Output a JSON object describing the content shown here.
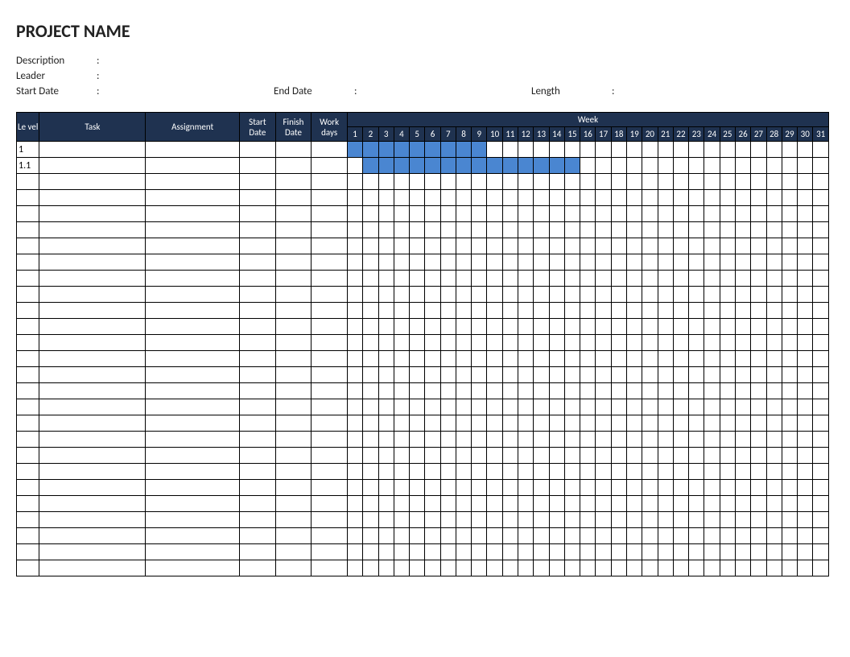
{
  "title": "PROJECT NAME",
  "meta": {
    "description_label": "Description",
    "leader_label": "Leader",
    "start_date_label": "Start Date",
    "end_date_label": "End Date",
    "length_label": "Length",
    "colon": ":"
  },
  "headers": {
    "level": "Le vel",
    "task": "Task",
    "assignment": "Assignment",
    "start_date": "Start Date",
    "finish_date": "Finish Date",
    "work_days": "Work days",
    "week": "Week"
  },
  "day_count": 31,
  "rows": [
    {
      "level": "1",
      "bar_start": 1,
      "bar_end": 9
    },
    {
      "level": "1.1",
      "bar_start": 2,
      "bar_end": 15
    },
    {
      "level": ""
    },
    {
      "level": ""
    },
    {
      "level": ""
    },
    {
      "level": ""
    },
    {
      "level": ""
    },
    {
      "level": ""
    },
    {
      "level": ""
    },
    {
      "level": ""
    },
    {
      "level": ""
    },
    {
      "level": ""
    },
    {
      "level": ""
    },
    {
      "level": ""
    },
    {
      "level": ""
    },
    {
      "level": ""
    },
    {
      "level": ""
    },
    {
      "level": ""
    },
    {
      "level": ""
    },
    {
      "level": ""
    },
    {
      "level": ""
    },
    {
      "level": ""
    },
    {
      "level": ""
    },
    {
      "level": ""
    },
    {
      "level": ""
    },
    {
      "level": ""
    },
    {
      "level": ""
    }
  ]
}
